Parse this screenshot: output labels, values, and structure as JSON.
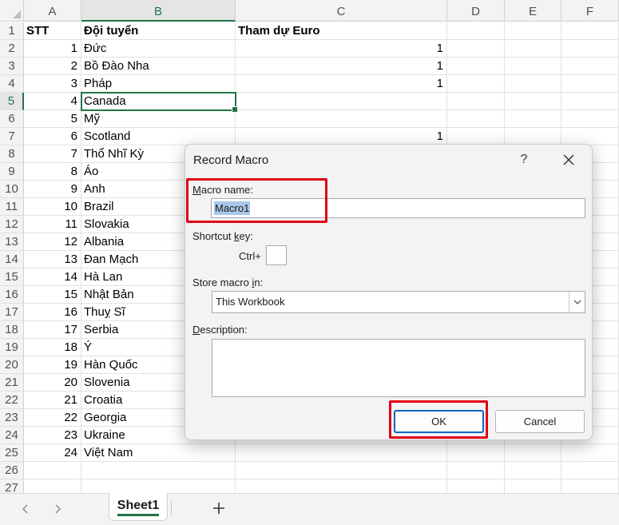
{
  "columns": [
    "A",
    "B",
    "C",
    "D",
    "E",
    "F"
  ],
  "rows": [
    {
      "num": "1",
      "a": "STT",
      "b": "Đội tuyển",
      "c": "Tham dự Euro"
    },
    {
      "num": "2",
      "a": "1",
      "b": "Đức",
      "c": "1"
    },
    {
      "num": "3",
      "a": "2",
      "b": "Bồ Đào Nha",
      "c": "1"
    },
    {
      "num": "4",
      "a": "3",
      "b": "Pháp",
      "c": "1"
    },
    {
      "num": "5",
      "a": "4",
      "b": "Canada",
      "c": ""
    },
    {
      "num": "6",
      "a": "5",
      "b": "Mỹ",
      "c": ""
    },
    {
      "num": "7",
      "a": "6",
      "b": "Scotland",
      "c": "1"
    },
    {
      "num": "8",
      "a": "7",
      "b": "Thổ Nhĩ Kỳ",
      "c": ""
    },
    {
      "num": "9",
      "a": "8",
      "b": "Áo",
      "c": ""
    },
    {
      "num": "10",
      "a": "9",
      "b": "Anh",
      "c": ""
    },
    {
      "num": "11",
      "a": "10",
      "b": "Brazil",
      "c": ""
    },
    {
      "num": "12",
      "a": "11",
      "b": "Slovakia",
      "c": ""
    },
    {
      "num": "13",
      "a": "12",
      "b": "Albania",
      "c": ""
    },
    {
      "num": "14",
      "a": "13",
      "b": "Đan Mạch",
      "c": ""
    },
    {
      "num": "15",
      "a": "14",
      "b": "Hà Lan",
      "c": ""
    },
    {
      "num": "16",
      "a": "15",
      "b": "Nhật Bản",
      "c": ""
    },
    {
      "num": "17",
      "a": "16",
      "b": "Thuỵ Sĩ",
      "c": ""
    },
    {
      "num": "18",
      "a": "17",
      "b": "Serbia",
      "c": ""
    },
    {
      "num": "19",
      "a": "18",
      "b": "Ý",
      "c": ""
    },
    {
      "num": "20",
      "a": "19",
      "b": "Hàn Quốc",
      "c": ""
    },
    {
      "num": "21",
      "a": "20",
      "b": "Slovenia",
      "c": ""
    },
    {
      "num": "22",
      "a": "21",
      "b": "Croatia",
      "c": ""
    },
    {
      "num": "23",
      "a": "22",
      "b": "Georgia",
      "c": ""
    },
    {
      "num": "24",
      "a": "23",
      "b": "Ukraine",
      "c": ""
    },
    {
      "num": "25",
      "a": "24",
      "b": "Việt Nam",
      "c": ""
    },
    {
      "num": "26",
      "a": "",
      "b": "",
      "c": ""
    },
    {
      "num": "27",
      "a": "",
      "b": "",
      "c": ""
    }
  ],
  "selection": {
    "column": "B",
    "row": "5"
  },
  "tabbar": {
    "prev_icon": "chevron-left-icon",
    "next_icon": "chevron-right-icon",
    "sheet_name": "Sheet1",
    "add_icon": "plus-icon"
  },
  "dialog": {
    "title": "Record Macro",
    "help_label": "?",
    "close_label": "✕",
    "macro_name_label_prefix": "M",
    "macro_name_label_rest": "acro name:",
    "macro_name_value": "Macro1",
    "shortcut_label_prefix": "Shortcut ",
    "shortcut_label_key": "k",
    "shortcut_label_rest": "ey:",
    "ctrl_label": "Ctrl+",
    "shortcut_value": "",
    "store_label_prefix": "Store macro ",
    "store_label_key": "i",
    "store_label_rest": "n:",
    "store_value": "This Workbook",
    "description_label_prefix": "D",
    "description_label_rest": "escription:",
    "description_value": "",
    "ok_label": "OK",
    "cancel_label": "Cancel"
  },
  "colors": {
    "accent": "#217346",
    "highlight": "#e00015",
    "primary_button_border": "#0067c0"
  }
}
